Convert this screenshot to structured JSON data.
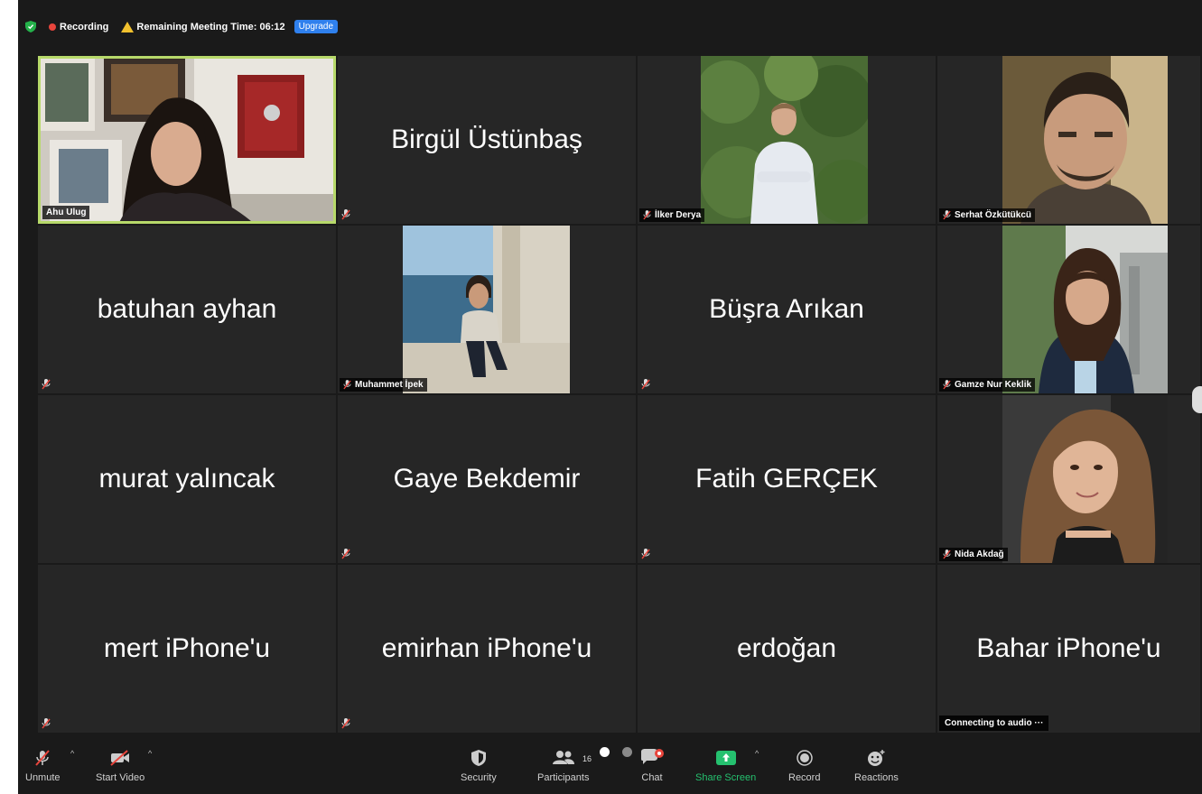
{
  "topbar": {
    "recording_label": "Recording",
    "remaining_label": "Remaining Meeting Time: 06:12",
    "upgrade_label": "Upgrade"
  },
  "tiles": [
    {
      "name": "Ahu Ulug",
      "type": "video"
    },
    {
      "name": "Birgül Üstünbaş",
      "type": "name"
    },
    {
      "name": "İlker Derya",
      "type": "video"
    },
    {
      "name": "Serhat Özkütükcü",
      "type": "video"
    },
    {
      "name": "batuhan ayhan",
      "type": "name"
    },
    {
      "name": "Muhammet İpek",
      "type": "video"
    },
    {
      "name": "Büşra Arıkan",
      "type": "name"
    },
    {
      "name": "Gamze Nur Keklik",
      "type": "video"
    },
    {
      "name": "murat yalıncak",
      "type": "name"
    },
    {
      "name": "Gaye Bekdemir",
      "type": "name"
    },
    {
      "name": "Fatih GERÇEK",
      "type": "name"
    },
    {
      "name": "Nida Akdağ",
      "type": "video"
    },
    {
      "name": "mert iPhone'u",
      "type": "name"
    },
    {
      "name": "emirhan iPhone'u",
      "type": "name"
    },
    {
      "name": "erdoğan",
      "type": "name"
    },
    {
      "name": "Bahar iPhone'u",
      "type": "name",
      "status": "Connecting to audio ···"
    }
  ],
  "toolbar": {
    "unmute_label": "Unmute",
    "start_video_label": "Start Video",
    "security_label": "Security",
    "participants_label": "Participants",
    "participants_count": "16",
    "chat_label": "Chat",
    "share_screen_label": "Share Screen",
    "record_label": "Record",
    "reactions_label": "Reactions"
  },
  "colors": {
    "active_speaker_border": "#b7d96a",
    "share_green": "#25c16f",
    "recording_red": "#e8453c",
    "upgrade_blue": "#2f80ed"
  }
}
